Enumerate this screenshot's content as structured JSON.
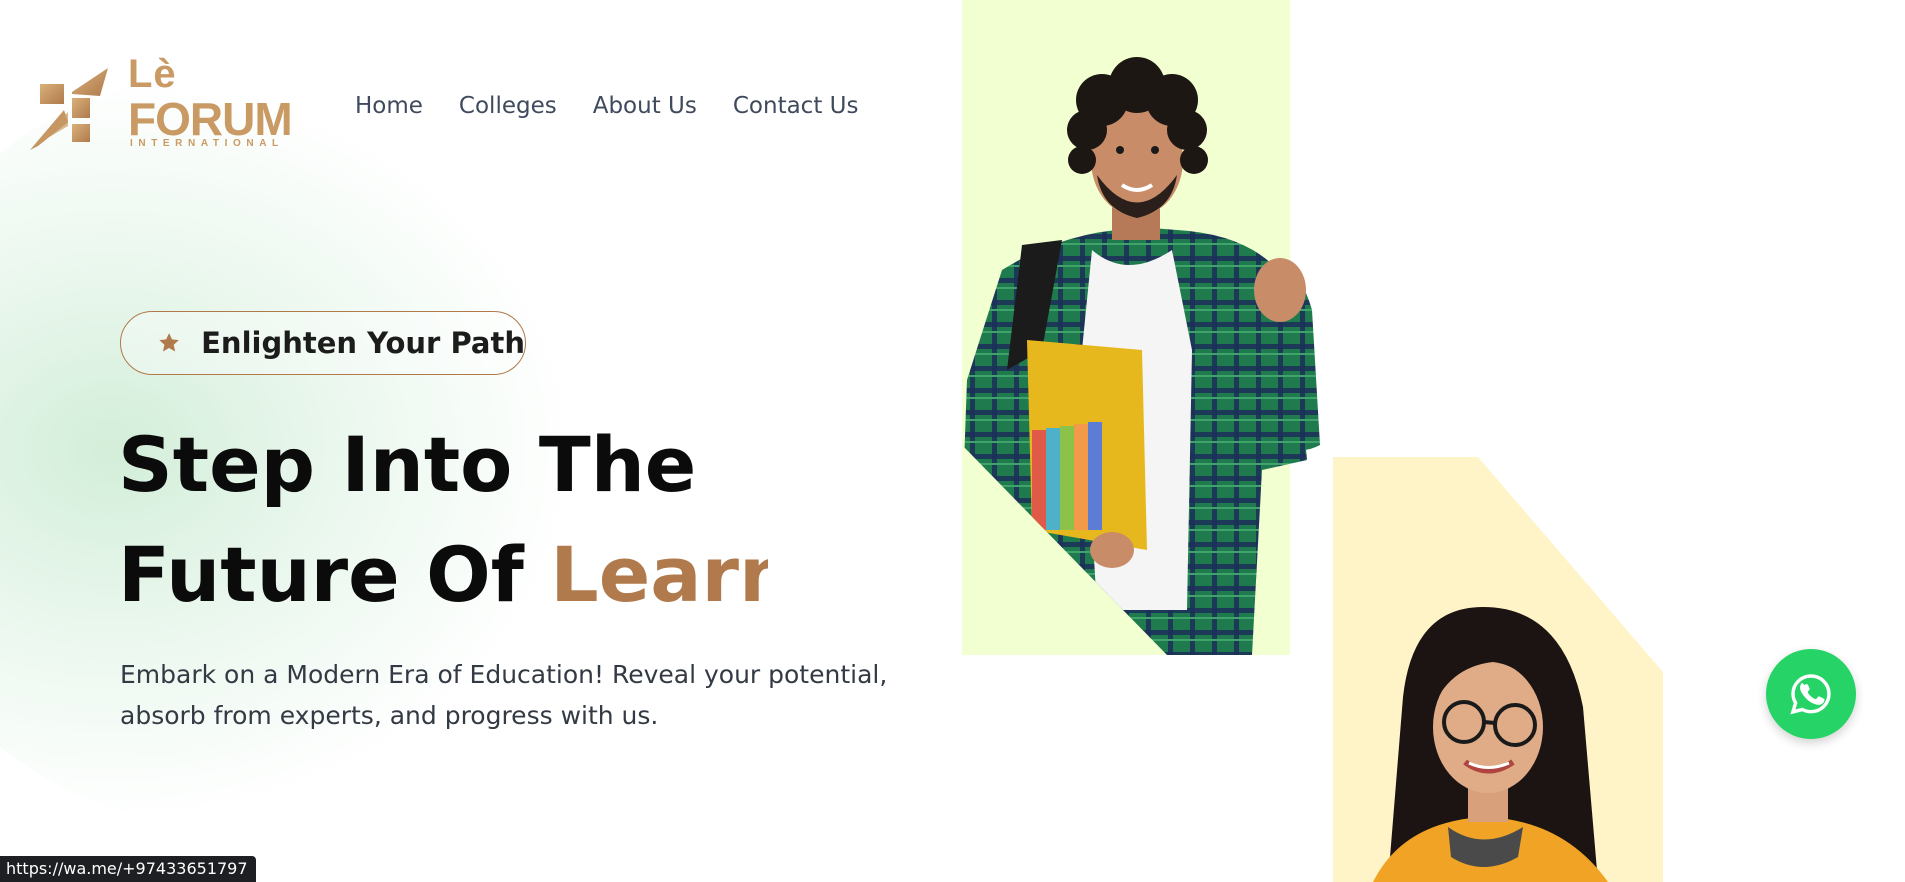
{
  "logo": {
    "line1": "Lè",
    "line2": "FORUM",
    "line3": "INTERNATIONAL",
    "color": "#c99a63"
  },
  "nav": {
    "items": [
      {
        "label": "Home"
      },
      {
        "label": "Colleges"
      },
      {
        "label": "About Us"
      },
      {
        "label": "Contact Us"
      }
    ]
  },
  "hero": {
    "badge": {
      "icon": "star-icon",
      "label": "Enlighten Your Path"
    },
    "headline_line1": "Step Into The",
    "headline_line2_prefix": "Future Of ",
    "headline_line2_accent": "Learn",
    "subtext": "Embark on a Modern Era of Education! Reveal your potential, absorb from experts, and progress with us.",
    "accent_color": "#b07a4c"
  },
  "images": {
    "photo1_bg_color": "#f2ffd0",
    "photo2_bg_color": "#fff4c8"
  },
  "whatsapp": {
    "icon": "whatsapp-icon",
    "color": "#25d366"
  },
  "statusbar": {
    "url": "https://wa.me/+97433651797"
  }
}
